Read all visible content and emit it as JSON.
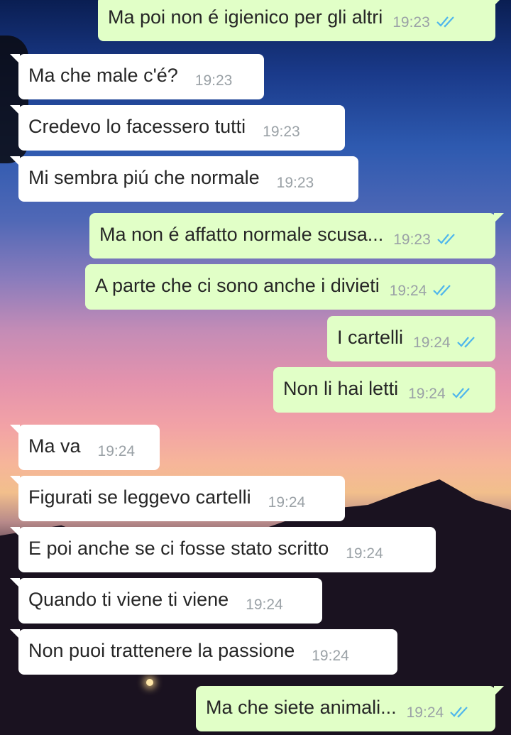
{
  "messages": [
    {
      "dir": "out",
      "text": "Ma poi non é igienico per gli altri",
      "time": "19:23",
      "read": true
    },
    {
      "dir": "in",
      "text": "Ma che male c'é?",
      "time": "19:23"
    },
    {
      "dir": "in",
      "text": "Credevo lo facessero tutti",
      "time": "19:23"
    },
    {
      "dir": "in",
      "text": "Mi sembra piú che normale",
      "time": "19:23"
    },
    {
      "dir": "out",
      "text": "Ma non é affatto normale scusa...",
      "time": "19:23",
      "read": true
    },
    {
      "dir": "out",
      "text": "A parte che ci sono anche i divieti",
      "time": "19:24",
      "read": true
    },
    {
      "dir": "out",
      "text": "I cartelli",
      "time": "19:24",
      "read": true
    },
    {
      "dir": "out",
      "text": "Non li hai letti",
      "time": "19:24",
      "read": true
    },
    {
      "dir": "in",
      "text": "Ma va",
      "time": "19:24"
    },
    {
      "dir": "in",
      "text": "Figurati se leggevo cartelli",
      "time": "19:24"
    },
    {
      "dir": "in",
      "text": "E poi anche se ci fosse stato scritto",
      "time": "19:24"
    },
    {
      "dir": "in",
      "text": "Quando ti viene ti viene",
      "time": "19:24"
    },
    {
      "dir": "in",
      "text": "Non puoi trattenere la passione",
      "time": "19:24"
    },
    {
      "dir": "out",
      "text": "Ma che siete animali...",
      "time": "19:24",
      "read": true
    }
  ],
  "colors": {
    "incoming_bubble": "#ffffff",
    "outgoing_bubble": "#e1ffc7",
    "read_ticks": "#4fb6ec",
    "timestamp": "#9aa1a6"
  },
  "icons": {
    "read_receipt": "double-check-icon"
  }
}
